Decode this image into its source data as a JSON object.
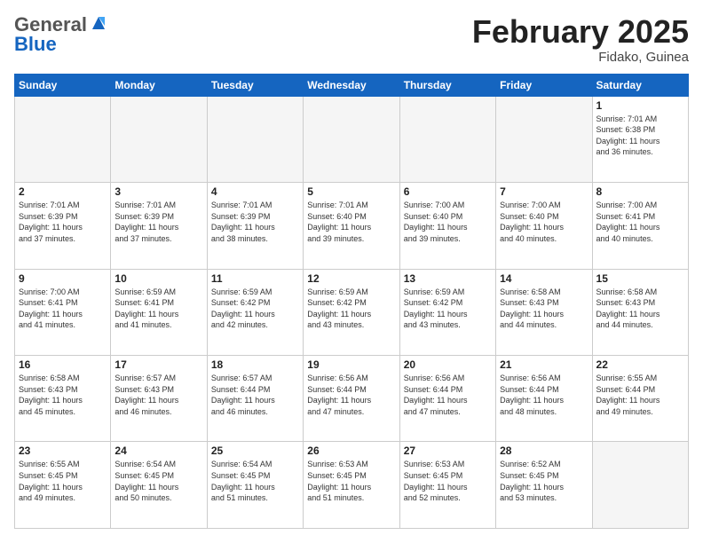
{
  "logo": {
    "general": "General",
    "blue": "Blue"
  },
  "header": {
    "month": "February 2025",
    "location": "Fidako, Guinea"
  },
  "weekdays": [
    "Sunday",
    "Monday",
    "Tuesday",
    "Wednesday",
    "Thursday",
    "Friday",
    "Saturday"
  ],
  "weeks": [
    [
      {
        "day": "",
        "info": ""
      },
      {
        "day": "",
        "info": ""
      },
      {
        "day": "",
        "info": ""
      },
      {
        "day": "",
        "info": ""
      },
      {
        "day": "",
        "info": ""
      },
      {
        "day": "",
        "info": ""
      },
      {
        "day": "1",
        "info": "Sunrise: 7:01 AM\nSunset: 6:38 PM\nDaylight: 11 hours\nand 36 minutes."
      }
    ],
    [
      {
        "day": "2",
        "info": "Sunrise: 7:01 AM\nSunset: 6:39 PM\nDaylight: 11 hours\nand 37 minutes."
      },
      {
        "day": "3",
        "info": "Sunrise: 7:01 AM\nSunset: 6:39 PM\nDaylight: 11 hours\nand 37 minutes."
      },
      {
        "day": "4",
        "info": "Sunrise: 7:01 AM\nSunset: 6:39 PM\nDaylight: 11 hours\nand 38 minutes."
      },
      {
        "day": "5",
        "info": "Sunrise: 7:01 AM\nSunset: 6:40 PM\nDaylight: 11 hours\nand 39 minutes."
      },
      {
        "day": "6",
        "info": "Sunrise: 7:00 AM\nSunset: 6:40 PM\nDaylight: 11 hours\nand 39 minutes."
      },
      {
        "day": "7",
        "info": "Sunrise: 7:00 AM\nSunset: 6:40 PM\nDaylight: 11 hours\nand 40 minutes."
      },
      {
        "day": "8",
        "info": "Sunrise: 7:00 AM\nSunset: 6:41 PM\nDaylight: 11 hours\nand 40 minutes."
      }
    ],
    [
      {
        "day": "9",
        "info": "Sunrise: 7:00 AM\nSunset: 6:41 PM\nDaylight: 11 hours\nand 41 minutes."
      },
      {
        "day": "10",
        "info": "Sunrise: 6:59 AM\nSunset: 6:41 PM\nDaylight: 11 hours\nand 41 minutes."
      },
      {
        "day": "11",
        "info": "Sunrise: 6:59 AM\nSunset: 6:42 PM\nDaylight: 11 hours\nand 42 minutes."
      },
      {
        "day": "12",
        "info": "Sunrise: 6:59 AM\nSunset: 6:42 PM\nDaylight: 11 hours\nand 43 minutes."
      },
      {
        "day": "13",
        "info": "Sunrise: 6:59 AM\nSunset: 6:42 PM\nDaylight: 11 hours\nand 43 minutes."
      },
      {
        "day": "14",
        "info": "Sunrise: 6:58 AM\nSunset: 6:43 PM\nDaylight: 11 hours\nand 44 minutes."
      },
      {
        "day": "15",
        "info": "Sunrise: 6:58 AM\nSunset: 6:43 PM\nDaylight: 11 hours\nand 44 minutes."
      }
    ],
    [
      {
        "day": "16",
        "info": "Sunrise: 6:58 AM\nSunset: 6:43 PM\nDaylight: 11 hours\nand 45 minutes."
      },
      {
        "day": "17",
        "info": "Sunrise: 6:57 AM\nSunset: 6:43 PM\nDaylight: 11 hours\nand 46 minutes."
      },
      {
        "day": "18",
        "info": "Sunrise: 6:57 AM\nSunset: 6:44 PM\nDaylight: 11 hours\nand 46 minutes."
      },
      {
        "day": "19",
        "info": "Sunrise: 6:56 AM\nSunset: 6:44 PM\nDaylight: 11 hours\nand 47 minutes."
      },
      {
        "day": "20",
        "info": "Sunrise: 6:56 AM\nSunset: 6:44 PM\nDaylight: 11 hours\nand 47 minutes."
      },
      {
        "day": "21",
        "info": "Sunrise: 6:56 AM\nSunset: 6:44 PM\nDaylight: 11 hours\nand 48 minutes."
      },
      {
        "day": "22",
        "info": "Sunrise: 6:55 AM\nSunset: 6:44 PM\nDaylight: 11 hours\nand 49 minutes."
      }
    ],
    [
      {
        "day": "23",
        "info": "Sunrise: 6:55 AM\nSunset: 6:45 PM\nDaylight: 11 hours\nand 49 minutes."
      },
      {
        "day": "24",
        "info": "Sunrise: 6:54 AM\nSunset: 6:45 PM\nDaylight: 11 hours\nand 50 minutes."
      },
      {
        "day": "25",
        "info": "Sunrise: 6:54 AM\nSunset: 6:45 PM\nDaylight: 11 hours\nand 51 minutes."
      },
      {
        "day": "26",
        "info": "Sunrise: 6:53 AM\nSunset: 6:45 PM\nDaylight: 11 hours\nand 51 minutes."
      },
      {
        "day": "27",
        "info": "Sunrise: 6:53 AM\nSunset: 6:45 PM\nDaylight: 11 hours\nand 52 minutes."
      },
      {
        "day": "28",
        "info": "Sunrise: 6:52 AM\nSunset: 6:45 PM\nDaylight: 11 hours\nand 53 minutes."
      },
      {
        "day": "",
        "info": ""
      }
    ]
  ]
}
